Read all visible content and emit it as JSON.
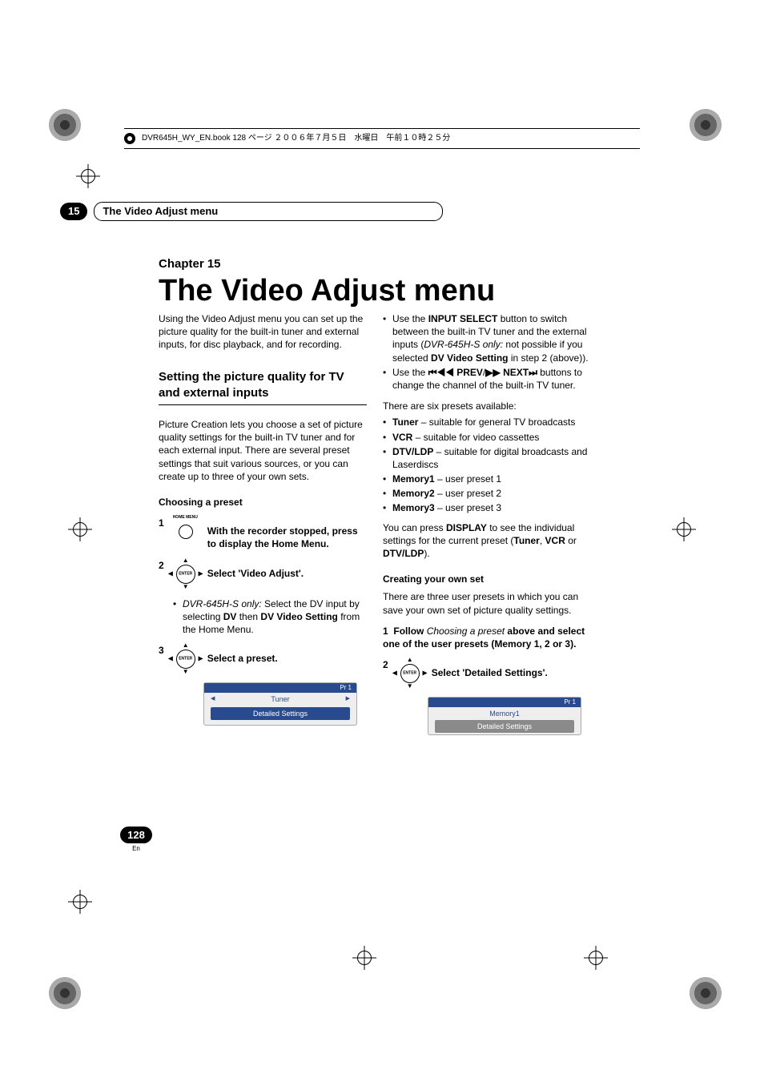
{
  "book_header": "DVR645H_WY_EN.book  128 ページ  ２００６年７月５日　水曜日　午前１０時２５分",
  "section": {
    "num": "15",
    "title": "The Video Adjust menu"
  },
  "chapter": {
    "label": "Chapter 15",
    "title": "The Video Adjust menu"
  },
  "intro": "Using the Video Adjust menu you can set up the picture quality for the built-in tuner and external inputs, for disc playback, and for recording.",
  "h2_picture": "Setting the picture quality for TV and external inputs",
  "picture_body": "Picture Creation lets you choose a set of picture quality settings for the built-in TV tuner and for each external input. There are several preset settings that suit various sources, or you can create up to three of your own sets.",
  "h3_choosing": "Choosing a preset",
  "step1": {
    "num": "1",
    "icon_label": "HOME MENU",
    "text": "With the recorder stopped, press to display the Home Menu."
  },
  "step2": {
    "num": "2",
    "text": "Select 'Video Adjust'."
  },
  "step2_note": {
    "model": "DVR-645H-S only:",
    "rest1": " Select the DV input by selecting ",
    "dv": "DV",
    "rest2": " then ",
    "dvs": "DV Video Setting",
    "rest3": " from the Home Menu."
  },
  "step3": {
    "num": "3",
    "text": "Select a preset."
  },
  "osd1": {
    "bar": "Pr 1",
    "top_left": "◀",
    "top_mid": "Tuner",
    "top_right": "▶",
    "btn": "Detailed Settings"
  },
  "right": {
    "b1_a": "Use the ",
    "b1_b": "INPUT SELECT",
    "b1_c": " button to switch between the built-in TV tuner and the external inputs (",
    "b1_d": "DVR-645H-S only:",
    "b1_e": " not possible if you selected ",
    "b1_f": "DV Video Setting",
    "b1_g": " in step 2 (above)).",
    "b2_a": "Use the ",
    "b2_b": "◀◀ PREV",
    "b2_c": "/",
    "b2_d": "▶▶ NEXT",
    "b2_e": " buttons to change the channel of the built-in TV tuner.",
    "presets_intro": "There are six presets available:",
    "p1_a": "Tuner",
    "p1_b": " – suitable for general TV broadcasts",
    "p2_a": "VCR",
    "p2_b": " – suitable for video cassettes",
    "p3_a": "DTV/LDP",
    "p3_b": " – suitable for digital broadcasts and Laserdiscs",
    "p4_a": "Memory1",
    "p4_b": " – user preset 1",
    "p5_a": "Memory2",
    "p5_b": " – user preset 2",
    "p6_a": "Memory3",
    "p6_b": " – user preset 3",
    "disp_a": "You can press ",
    "disp_b": "DISPLAY",
    "disp_c": " to see the individual settings for the current preset (",
    "disp_d": "Tuner",
    "disp_e": ", ",
    "disp_f": "VCR",
    "disp_g": " or ",
    "disp_h": "DTV/LDP",
    "disp_i": ").",
    "h3_own": "Creating your own set",
    "own_body": "There are three user presets in which you can save your own set of picture quality settings.",
    "own1_num": "1",
    "own1_a": "Follow ",
    "own1_b": "Choosing a preset",
    "own1_c": " above and select one of the user presets (Memory 1, 2 or 3).",
    "own2_num": "2",
    "own2_text": "Select 'Detailed Settings'.",
    "osd2": {
      "bar": "Pr 1",
      "row1": "Memory1",
      "row2": "Detailed Settings"
    }
  },
  "page": {
    "num": "128",
    "lang": "En"
  }
}
